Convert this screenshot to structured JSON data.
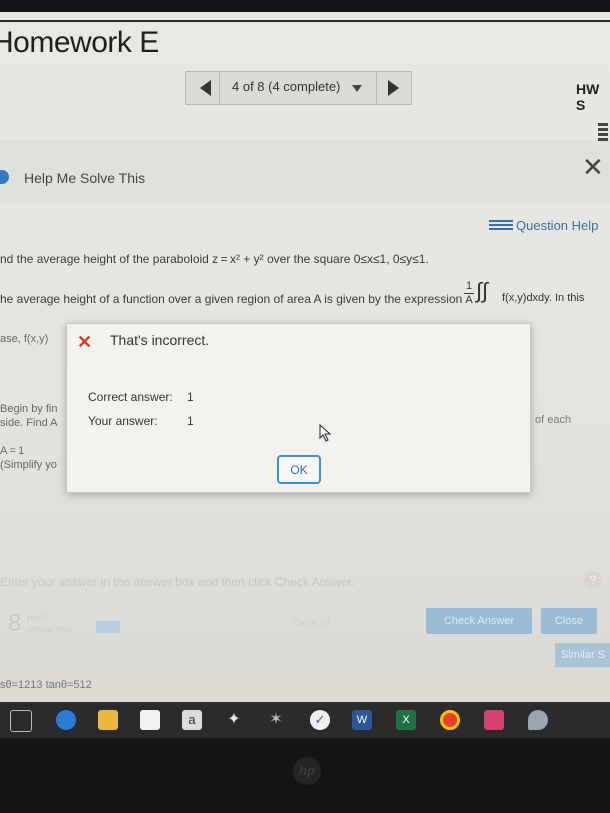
{
  "app": {
    "title": "Homework E",
    "score_label": "HW S"
  },
  "nav": {
    "position_label": "4 of 8 (4 complete)"
  },
  "panel": {
    "help_label": "Help Me Solve This",
    "question_help_label": "Question Help"
  },
  "question": {
    "line1": "nd the average height of the paraboloid z = x² + y² over the square 0≤x≤1, 0≤y≤1.",
    "line2": "he average height of a function over a given region of area A is given by the expression",
    "line2_tail": "f(x,y)dxdy. In this",
    "frac_num": "1",
    "frac_den": "A",
    "left_case": "ase, f(x,y)",
    "left_begin": "Begin by fin",
    "left_side": "side. Find A",
    "left_a": "A = 1",
    "left_simplify": "(Simplify yo",
    "right_snip": "of each"
  },
  "dialog": {
    "message": "That's incorrect.",
    "correct_label": "Correct answer:",
    "correct_value": "1",
    "your_label": "Your answer:",
    "your_value": "1",
    "ok_label": "OK"
  },
  "footer": {
    "instruction": "Enter your answer in the answer box and then click Check Answer.",
    "parts_count": "8",
    "parts_line1": "parts",
    "parts_line2": "remaining",
    "clear_all": "Clear All",
    "check_answer": "Check Answer",
    "close": "Close",
    "similar": "Similar S",
    "formula_strip": "sθ=1213 tanθ=512"
  },
  "taskbar": {
    "icons": [
      "task-view-icon",
      "edge-icon",
      "file-explorer-icon",
      "store-icon",
      "amazon-icon",
      "dropbox-icon",
      "settings-icon",
      "check-icon",
      "word-icon",
      "excel-icon",
      "chrome-icon",
      "photos-icon",
      "paint-icon"
    ]
  },
  "colors": {
    "accent": "#3a6ea5",
    "error": "#d43b2f",
    "button_bg": "#9bbbd3"
  }
}
